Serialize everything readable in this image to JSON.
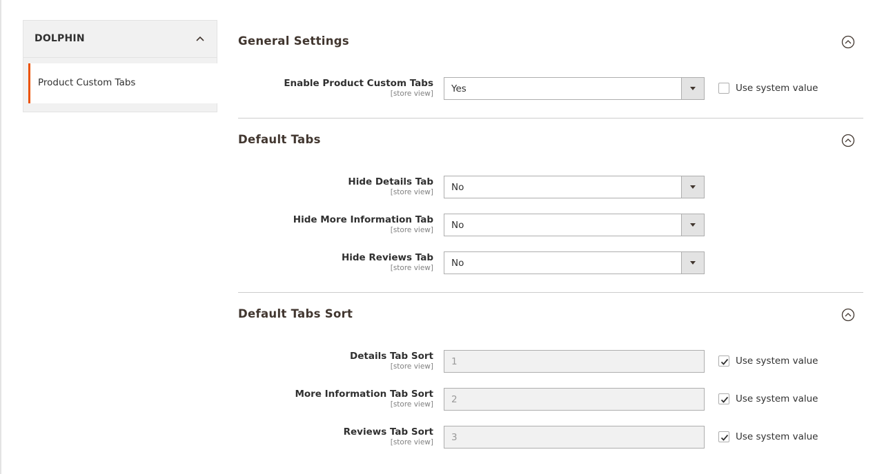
{
  "sidebar": {
    "title": "DOLPHIN",
    "items": [
      {
        "label": "Product Custom Tabs",
        "active": true
      }
    ]
  },
  "sections": {
    "general": {
      "title": "General Settings",
      "fields": {
        "enable": {
          "label": "Enable Product Custom Tabs",
          "scope": "[store view]",
          "value": "Yes",
          "use_system_label": "Use system value",
          "use_system": false
        }
      }
    },
    "default_tabs": {
      "title": "Default Tabs",
      "fields": {
        "hide_details": {
          "label": "Hide Details Tab",
          "scope": "[store view]",
          "value": "No"
        },
        "hide_more_info": {
          "label": "Hide More Information Tab",
          "scope": "[store view]",
          "value": "No"
        },
        "hide_reviews": {
          "label": "Hide Reviews Tab",
          "scope": "[store view]",
          "value": "No"
        }
      }
    },
    "default_tabs_sort": {
      "title": "Default Tabs Sort",
      "fields": {
        "details_sort": {
          "label": "Details Tab Sort",
          "scope": "[store view]",
          "value": "1",
          "use_system_label": "Use system value",
          "use_system": true
        },
        "more_info_sort": {
          "label": "More Information Tab Sort",
          "scope": "[store view]",
          "value": "2",
          "use_system_label": "Use system value",
          "use_system": true
        },
        "reviews_sort": {
          "label": "Reviews Tab Sort",
          "scope": "[store view]",
          "value": "3",
          "use_system_label": "Use system value",
          "use_system": true
        }
      }
    }
  },
  "colors": {
    "accent": "#eb5202",
    "panel": "#f1f1f1",
    "border": "#adadad"
  },
  "icons": {
    "sidebar_toggle": "chevron-up-icon",
    "section_toggle": "circle-chevron-up-icon",
    "select_arrow": "caret-down-icon",
    "checkbox_check": "checkmark-icon"
  }
}
